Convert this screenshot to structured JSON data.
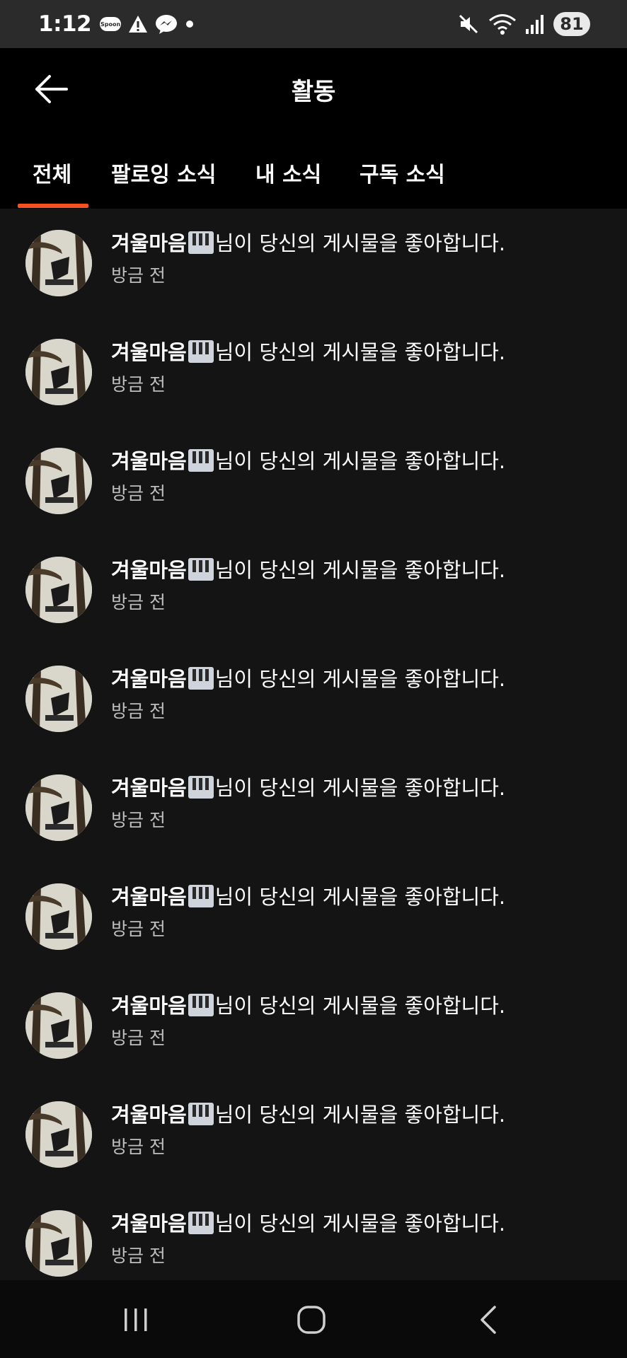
{
  "status_bar": {
    "time": "1:12",
    "left_icons": [
      "spoon-icon",
      "warning-icon",
      "messenger-icon",
      "dot-icon"
    ],
    "spoon_label": "Spoon",
    "right_icons": [
      "mute-icon",
      "wifi-icon",
      "signal-icon"
    ],
    "battery": "81"
  },
  "header": {
    "title": "활동",
    "back_icon": "arrow-left-icon"
  },
  "tabs": [
    {
      "label": "전체",
      "active": true
    },
    {
      "label": "팔로잉 소식",
      "active": false
    },
    {
      "label": "내 소식",
      "active": false
    },
    {
      "label": "구독 소식",
      "active": false
    }
  ],
  "accent_color": "#f4511e",
  "activities": [
    {
      "user": "겨울마음",
      "badge_icon": "piano-icon",
      "message": "님이 당신의 게시물을 좋아합니다.",
      "time": "방금 전"
    },
    {
      "user": "겨울마음",
      "badge_icon": "piano-icon",
      "message": "님이 당신의 게시물을 좋아합니다.",
      "time": "방금 전"
    },
    {
      "user": "겨울마음",
      "badge_icon": "piano-icon",
      "message": "님이 당신의 게시물을 좋아합니다.",
      "time": "방금 전"
    },
    {
      "user": "겨울마음",
      "badge_icon": "piano-icon",
      "message": "님이 당신의 게시물을 좋아합니다.",
      "time": "방금 전"
    },
    {
      "user": "겨울마음",
      "badge_icon": "piano-icon",
      "message": "님이 당신의 게시물을 좋아합니다.",
      "time": "방금 전"
    },
    {
      "user": "겨울마음",
      "badge_icon": "piano-icon",
      "message": "님이 당신의 게시물을 좋아합니다.",
      "time": "방금 전"
    },
    {
      "user": "겨울마음",
      "badge_icon": "piano-icon",
      "message": "님이 당신의 게시물을 좋아합니다.",
      "time": "방금 전"
    },
    {
      "user": "겨울마음",
      "badge_icon": "piano-icon",
      "message": "님이 당신의 게시물을 좋아합니다.",
      "time": "방금 전"
    },
    {
      "user": "겨울마음",
      "badge_icon": "piano-icon",
      "message": "님이 당신의 게시물을 좋아합니다.",
      "time": "방금 전"
    },
    {
      "user": "겨울마음",
      "badge_icon": "piano-icon",
      "message": "님이 당신의 게시물을 좋아합니다.",
      "time": "방금 전"
    }
  ],
  "nav_bar": {
    "icons": [
      "recent-apps-icon",
      "home-icon",
      "back-icon"
    ]
  }
}
